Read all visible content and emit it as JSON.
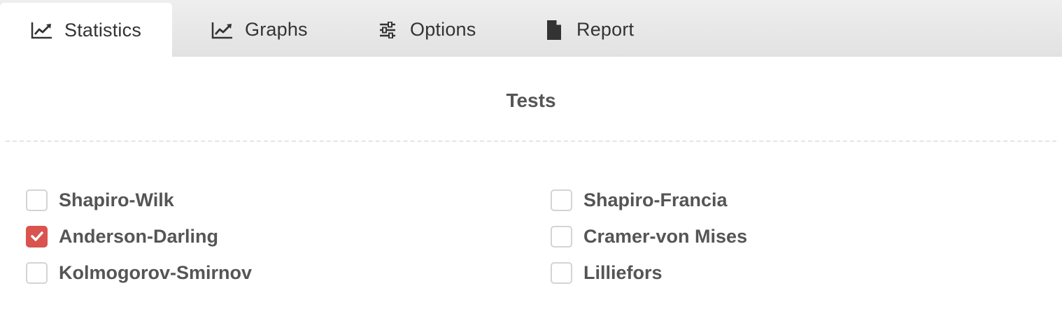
{
  "tabs": [
    {
      "label": "Statistics",
      "icon": "line-chart-icon",
      "active": true
    },
    {
      "label": "Graphs",
      "icon": "line-chart-icon",
      "active": false
    },
    {
      "label": "Options",
      "icon": "sliders-icon",
      "active": false
    },
    {
      "label": "Report",
      "icon": "file-icon",
      "active": false
    }
  ],
  "section": {
    "title": "Tests"
  },
  "tests": [
    {
      "label": "Shapiro-Wilk",
      "checked": false
    },
    {
      "label": "Anderson-Darling",
      "checked": true
    },
    {
      "label": "Kolmogorov-Smirnov",
      "checked": false
    },
    {
      "label": "Shapiro-Francia",
      "checked": false
    },
    {
      "label": "Cramer-von Mises",
      "checked": false
    },
    {
      "label": "Lilliefors",
      "checked": false
    }
  ],
  "colors": {
    "checked_fill": "#d9534f",
    "text": "#555555",
    "tab_text": "#333333"
  }
}
